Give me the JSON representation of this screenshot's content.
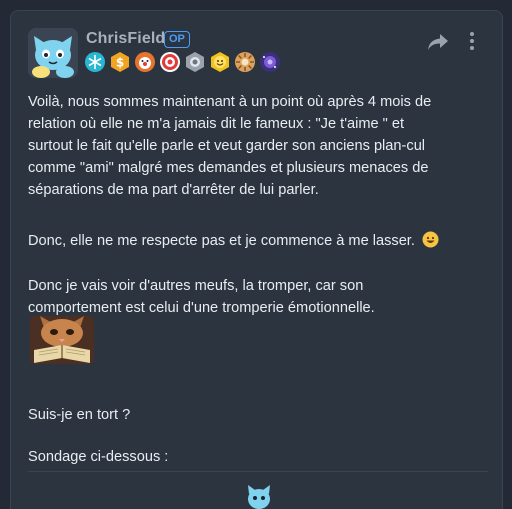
{
  "post": {
    "author": {
      "username": "ChrisField",
      "role_badge": "OP",
      "avatar_icon": "cartoon-cat-avatar-icon",
      "badges": [
        {
          "icon": "snowflake-badge-icon",
          "color": "#29b6d3"
        },
        {
          "icon": "dollar-coin-badge-icon",
          "color": "#f1a322"
        },
        {
          "icon": "clown-badge-icon",
          "color": "#e8742c"
        },
        {
          "icon": "bullseye-badge-icon",
          "color": "#e23b3b"
        },
        {
          "icon": "silver-medal-badge-icon",
          "color": "#9aa3ad"
        },
        {
          "icon": "smiley-badge-icon",
          "color": "#f1c21b"
        },
        {
          "icon": "sun-badge-icon",
          "color": "#d8a35c"
        },
        {
          "icon": "galaxy-badge-icon",
          "color": "#7b5bd6"
        }
      ]
    },
    "actions": {
      "share_icon": "share-arrow-icon",
      "more_icon": "more-vertical-icon"
    },
    "paragraphs": [
      {
        "lines": [
          "Voilà, nous sommes maintenant à un point où après 4 mois de",
          "relation où elle ne m'a jamais dit le fameux : \"Je t'aime \" et",
          "surtout le fait qu'elle parle et veut garder son anciens plan-cul",
          "comme \"ami\" malgré mes demandes et plusieurs menaces de",
          "séparations de ma part d'arrêter de lui parler."
        ]
      },
      {
        "lines": [
          "Donc, elle ne me respecte pas et je commence à me lasser."
        ],
        "trailing_emoji": "grinning-smiley-icon"
      },
      {
        "lines": [
          "Donc je vais voir d'autres meufs, la tromper, car son",
          "comportement est celui d'une tromperie émotionnelle."
        ]
      },
      {
        "lines": [
          "Suis-je en tort ?"
        ]
      },
      {
        "lines": [
          "Sondage ci-dessous :"
        ]
      }
    ],
    "sticker": "cat-reading-book-sticker",
    "footer_icon": "blue-cat-icon"
  },
  "colors": {
    "page_bg": "#232a35",
    "card_bg": "#2c3440",
    "text": "#e9edf1",
    "muted": "#a9b1bd",
    "accent": "#4a9df5"
  }
}
